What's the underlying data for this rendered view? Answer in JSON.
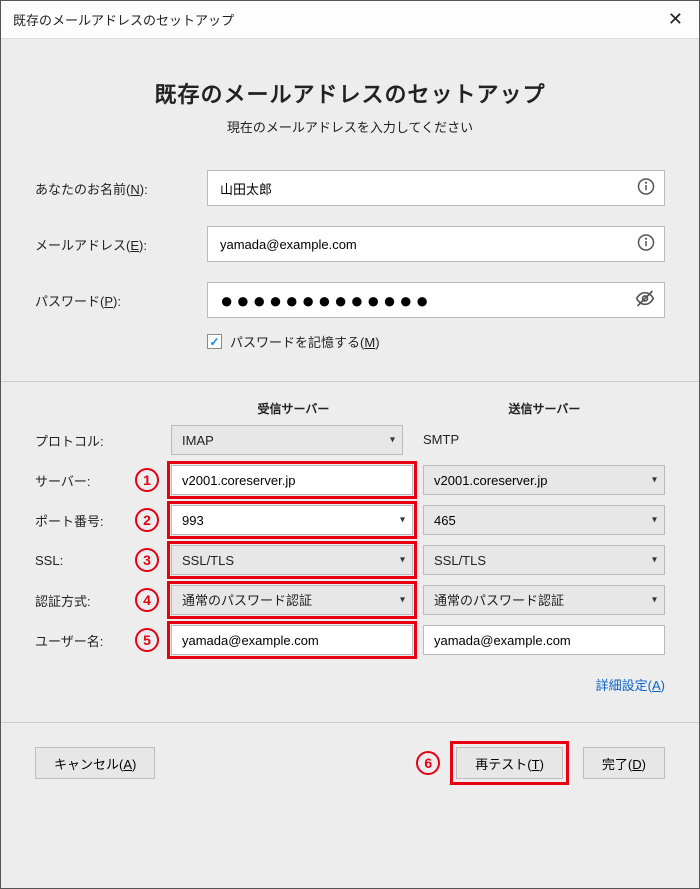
{
  "titlebar": {
    "title": "既存のメールアドレスのセットアップ"
  },
  "header": {
    "heading": "既存のメールアドレスのセットアップ",
    "sub": "現在のメールアドレスを入力してください"
  },
  "form": {
    "name_label_prefix": "あなたのお名前(",
    "name_label_key": "N",
    "name_label_suffix": "):",
    "name_value": "山田太郎",
    "email_label_prefix": "メールアドレス(",
    "email_label_key": "E",
    "email_label_suffix": "):",
    "email_value": "yamada@example.com",
    "password_label_prefix": "パスワード(",
    "password_label_key": "P",
    "password_label_suffix": "):",
    "password_dots": "●●●●●●●●●●●●●",
    "remember_prefix": "パスワードを記憶する(",
    "remember_key": "M",
    "remember_suffix": ")",
    "remember_checked": true
  },
  "server": {
    "header_incoming": "受信サーバー",
    "header_outgoing": "送信サーバー",
    "rows": {
      "protocol_label": "プロトコル:",
      "protocol_in": "IMAP",
      "protocol_out": "SMTP",
      "server_label": "サーバー:",
      "server_in": "v2001.coreserver.jp",
      "server_out": "v2001.coreserver.jp",
      "port_label": "ポート番号:",
      "port_in": "993",
      "port_out": "465",
      "ssl_label": "SSL:",
      "ssl_in": "SSL/TLS",
      "ssl_out": "SSL/TLS",
      "auth_label": "認証方式:",
      "auth_in": "通常のパスワード認証",
      "auth_out": "通常のパスワード認証",
      "user_label": "ユーザー名:",
      "user_in": "yamada@example.com",
      "user_out": "yamada@example.com"
    },
    "badges": {
      "b1": "1",
      "b2": "2",
      "b3": "3",
      "b4": "4",
      "b5": "5",
      "b6": "6"
    },
    "advanced_prefix": "詳細設定(",
    "advanced_key": "A",
    "advanced_suffix": ")"
  },
  "footer": {
    "cancel_prefix": "キャンセル(",
    "cancel_key": "A",
    "cancel_suffix": ")",
    "retest_prefix": "再テスト(",
    "retest_key": "T",
    "retest_suffix": ")",
    "done_prefix": "完了(",
    "done_key": "D",
    "done_suffix": ")"
  }
}
